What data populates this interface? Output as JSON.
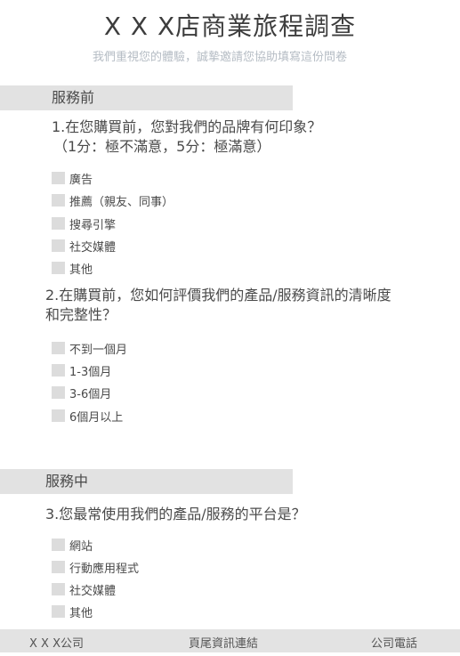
{
  "header": {
    "title": "X X X店商業旅程調查",
    "subtitle": "我們重視您的體驗，誠摯邀請您協助填寫這份問卷"
  },
  "sections": [
    {
      "label": "服務前",
      "questions": [
        {
          "lines": [
            "1.在您購買前，您對我們的品牌有何印象？",
            "（1分：極不滿意，5分：極滿意）"
          ],
          "options": [
            "廣告",
            "推薦（親友、同事）",
            "搜尋引擎",
            "社交媒體",
            "其他"
          ]
        },
        {
          "lines": [
            "2.在購買前，您如何評價我們的產品/服務資訊的清晰度",
            "和完整性？"
          ],
          "options": [
            "不到一個月",
            "1-3個月",
            "3-6個月",
            "6個月以上"
          ]
        }
      ]
    },
    {
      "label": "服務中",
      "questions": [
        {
          "lines": [
            "3.您最常使用我們的產品/服務的平台是？"
          ],
          "options": [
            "網站",
            "行動應用程式",
            "社交媒體",
            "其他"
          ]
        }
      ]
    }
  ],
  "footer": {
    "company": "X X X公司",
    "links": "頁尾資訊連結",
    "phone": "公司電話"
  }
}
